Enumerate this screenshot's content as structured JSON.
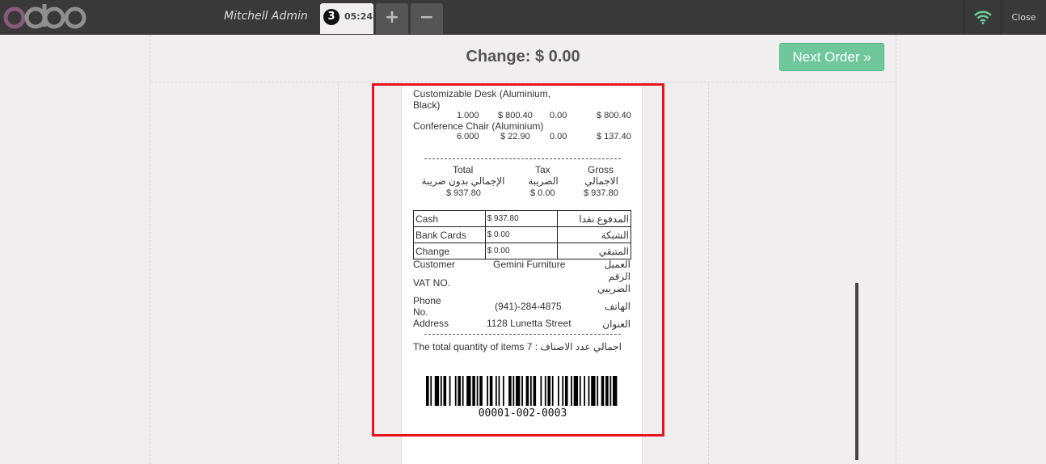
{
  "topbar": {
    "logo_text": "odoo",
    "cashier": "Mitchell Admin",
    "order": {
      "number": "3",
      "time": "05:24"
    },
    "add_label": "+",
    "remove_label": "−",
    "close_label": "Close",
    "brand_color": "#875A7B",
    "wifi_color": "#6ec89b"
  },
  "screen": {
    "change_title": "Change: $ 0.00",
    "next_order_label": "Next Order »"
  },
  "receipt": {
    "lines": [
      {
        "name": "Customizable Desk (Aluminium, Black)",
        "name_1": "Customizable Desk (Aluminium,",
        "name_2": "Black)",
        "qty": "1.000",
        "price": "$ 800.40",
        "tax": "0.00",
        "total": "$ 800.40"
      },
      {
        "name": "Conference Chair (Aluminium)",
        "qty": "6.000",
        "price": "$ 22.90",
        "tax": "0.00",
        "total": "$ 137.40"
      }
    ],
    "summary": {
      "total_label": "Total",
      "total_label_ar": "الإجمالي بدون ضريبة",
      "total_value": "$ 937.80",
      "tax_label": "Tax",
      "tax_label_ar": "الضريبة",
      "tax_value": "$ 0.00",
      "gross_label": "Gross",
      "gross_label_ar": "الاجمالي",
      "gross_value": "$ 937.80"
    },
    "payments": [
      {
        "label": "Cash",
        "amount": "$ 937.80",
        "label_ar": "المدفوع نقدا"
      },
      {
        "label": "Bank Cards",
        "amount": "$ 0.00",
        "label_ar": "الشبكة"
      },
      {
        "label": "Change",
        "amount": "$ 0.00",
        "label_ar": "المتبقي"
      }
    ],
    "customer": {
      "customer_label": "Customer",
      "customer_value": "Gemini Furniture",
      "customer_label_ar": "العميل",
      "vat_label": "VAT NO.",
      "vat_label_ar_1": "الرقم",
      "vat_label_ar_2": "الضريبي",
      "phone_label_1": "Phone",
      "phone_label_2": "No.",
      "phone_value": "(941)-284-4875",
      "phone_label_ar": "الهاتف",
      "address_label": "Address",
      "address_value": "1128 Lunetta Street",
      "address_label_ar": "العنوان"
    },
    "total_qty_text": "The total quantity of items 7 : اجمالي عدد الاصناف",
    "barcode_number": "00001-002-0003"
  }
}
